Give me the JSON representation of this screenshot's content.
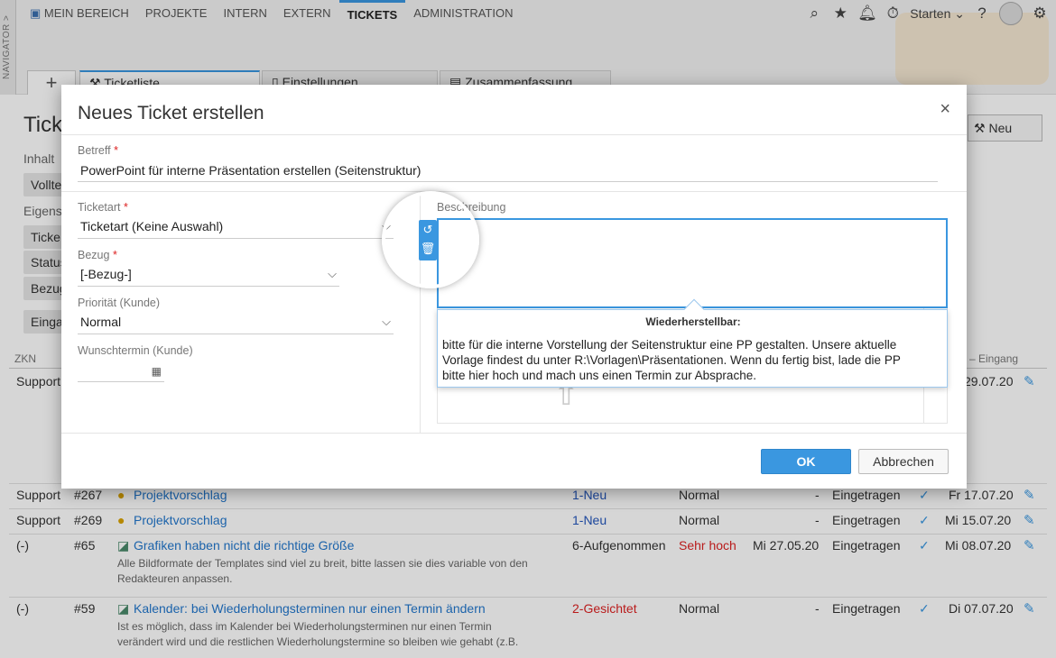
{
  "navigator": {
    "label": "NAVIGATOR >"
  },
  "topnav": {
    "items": [
      {
        "label": "MEIN BEREICH"
      },
      {
        "label": "PROJEKTE"
      },
      {
        "label": "INTERN"
      },
      {
        "label": "EXTERN"
      },
      {
        "label": "TICKETS"
      },
      {
        "label": "ADMINISTRATION"
      }
    ],
    "active": "TICKETS",
    "starten_label": "Starten"
  },
  "tabs": {
    "add_label": "+",
    "items": [
      {
        "label": "Ticketliste"
      },
      {
        "label": "Einstellungen"
      },
      {
        "label": "Zusammenfassung"
      }
    ]
  },
  "page": {
    "title": "Tick",
    "inhalt": "Inhalt",
    "vollte": "Vollte",
    "eigens": "Eigens",
    "ticket": "Ticke",
    "status": "Status",
    "bezug": "Bezug",
    "einga": "Einga",
    "neu_button": "Neu"
  },
  "table": {
    "headers": {
      "zkn": "ZKN",
      "eingang": "Eingang"
    },
    "rows": [
      {
        "zkn": "Support",
        "nr": "",
        "title": "",
        "status": "",
        "prio": "",
        "date": "",
        "state": "",
        "eingang": "29.07.20",
        "desc": ""
      },
      {
        "zkn": "Support",
        "nr": "#267",
        "title": "Projektvorschlag",
        "status": "1-Neu",
        "prio": "Normal",
        "date": "-",
        "state": "Eingetragen",
        "eingang": "Fr 17.07.20",
        "desc": ""
      },
      {
        "zkn": "Support",
        "nr": "#269",
        "title": "Projektvorschlag",
        "status": "1-Neu",
        "prio": "Normal",
        "date": "-",
        "state": "Eingetragen",
        "eingang": "Mi 15.07.20",
        "desc": ""
      },
      {
        "zkn": "(-)",
        "nr": "#65",
        "title": "Grafiken haben nicht die richtige Größe",
        "status": "6-Aufgenommen",
        "prio": "Sehr hoch",
        "date": "Mi 27.05.20",
        "state": "Eingetragen",
        "eingang": "Mi 08.07.20",
        "desc": "Alle Bildformate der Templates sind viel zu breit, bitte lassen sie dies variable von den Redakteuren anpassen."
      },
      {
        "zkn": "(-)",
        "nr": "#59",
        "title": "Kalender: bei Wiederholungsterminen nur einen Termin ändern",
        "status": "2-Gesichtet",
        "prio": "Normal",
        "date": "-",
        "state": "Eingetragen",
        "eingang": "Di 07.07.20",
        "desc": "Ist es möglich, dass im Kalender bei Wiederholungsterminen nur einen Termin verändert wird und die restlichen Wiederholungstermine so bleiben wie gehabt (z.B."
      }
    ]
  },
  "modal": {
    "title": "Neues Ticket erstellen",
    "close_label": "×",
    "betreff": {
      "label": "Betreff",
      "required": "*",
      "value": "PowerPoint für interne Präsentation erstellen (Seitenstruktur)"
    },
    "ticketart": {
      "label": "Ticketart",
      "required": "*",
      "value": "Ticketart (Keine Auswahl)"
    },
    "bezug": {
      "label": "Bezug",
      "required": "*",
      "value": "[-Bezug-]"
    },
    "prioritaet": {
      "label": "Priorität (Kunde)",
      "value": "Normal"
    },
    "wunschtermin": {
      "label": "Wunschtermin (Kunde)",
      "value": ""
    },
    "beschreibung": {
      "label": "Beschreibung",
      "value": ""
    },
    "tooltip": {
      "title": "Wiederherstellbar:",
      "text": "bitte für die interne Vorstellung der Seitenstruktur eine PP gestalten. Unsere aktuelle Vorlage findest du unter R:\\Vorlagen\\Präsentationen. Wenn du fertig bist, lade die PP bitte hier hoch und mach uns einen Termin zur Absprache."
    },
    "ok_label": "OK",
    "cancel_label": "Abbrechen"
  },
  "colors": {
    "accent": "#3a97e0",
    "required": "#dd2222"
  }
}
